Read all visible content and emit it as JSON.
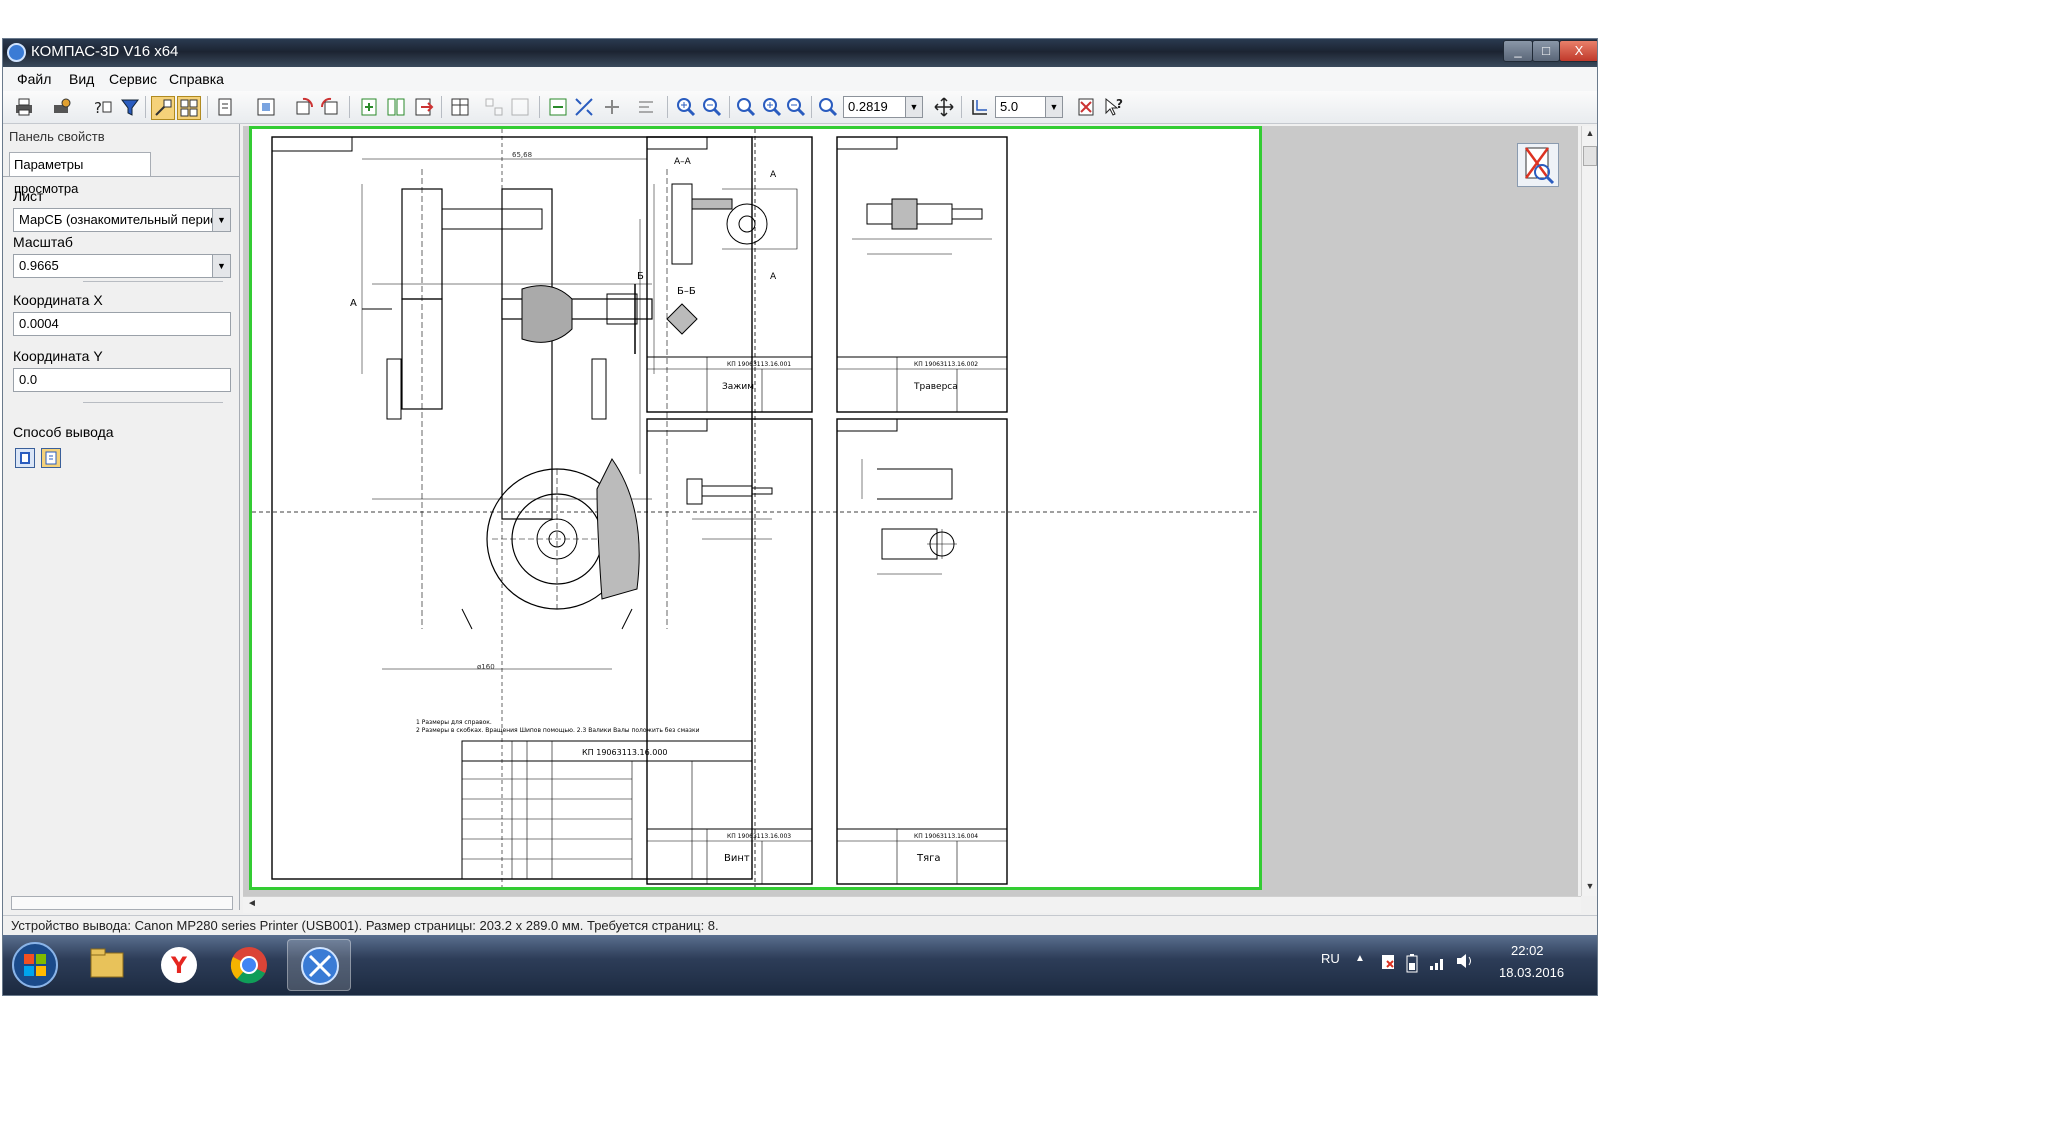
{
  "window": {
    "title": "КОМПАС-3D V16  x64",
    "buttons": [
      "_",
      "□",
      "X"
    ]
  },
  "menu": {
    "items": [
      "Файл",
      "Вид",
      "Сервис",
      "Справка"
    ]
  },
  "toolbar": {
    "zoom_value": "0.2819",
    "step_value": "5.0",
    "icons": [
      "print-icon",
      "print-settings-icon",
      "help-icon",
      "filter-icon",
      "zoom-in-icon",
      "zoom-out-icon",
      "pan-icon",
      "snap-icon",
      "context-help-icon"
    ]
  },
  "properties_panel": {
    "title": "Панель свойств",
    "tab": "Параметры просмотра",
    "sheet_label": "Лист",
    "sheet_value": "МарСБ (ознакомительный перио",
    "scale_label": "Масштаб",
    "scale_value": "0.9665",
    "coord_x_label": "Координата X",
    "coord_x_value": "0.0004",
    "coord_y_label": "Координата Y",
    "coord_y_value": "0.0",
    "output_label": "Способ вывода"
  },
  "sheets": {
    "sheet1": {
      "stamp_text": "КП 19063113.16.000",
      "notes": [
        "1 Размеры для справок.",
        "2 Размеры в скобках. Вращения Шипов помощью. 2.3 Валики Валы положить без смазки"
      ],
      "labels": [
        "А",
        "Б",
        "Б–Б",
        "А"
      ]
    },
    "sheet2": {
      "title": "Зажим",
      "code": "КП 19063113.16.001",
      "labels": [
        "А–А",
        "А",
        "А"
      ]
    },
    "sheet3": {
      "title": "Траверса",
      "code": "КП 19063113.16.002"
    },
    "sheet4": {
      "title": "Винт",
      "code": "КП 19063113.16.003"
    },
    "sheet5": {
      "title": "Тяга",
      "code": "КП 19063113.16.004"
    }
  },
  "status": {
    "text": "Устройство вывода: Canon MP280 series Printer (USB001). Размер страницы: 203.2 x 289.0 мм. Требуется страниц: 8."
  },
  "taskbar": {
    "apps": [
      "windows-start",
      "file-explorer",
      "yandex-browser",
      "chrome",
      "kompas-3d"
    ],
    "lang": "RU",
    "time": "22:02",
    "date": "18.03.2016"
  },
  "colors": {
    "accent_green": "#33cc33",
    "taskbar": "#2d3d58",
    "titlebar": "#1c2432"
  }
}
